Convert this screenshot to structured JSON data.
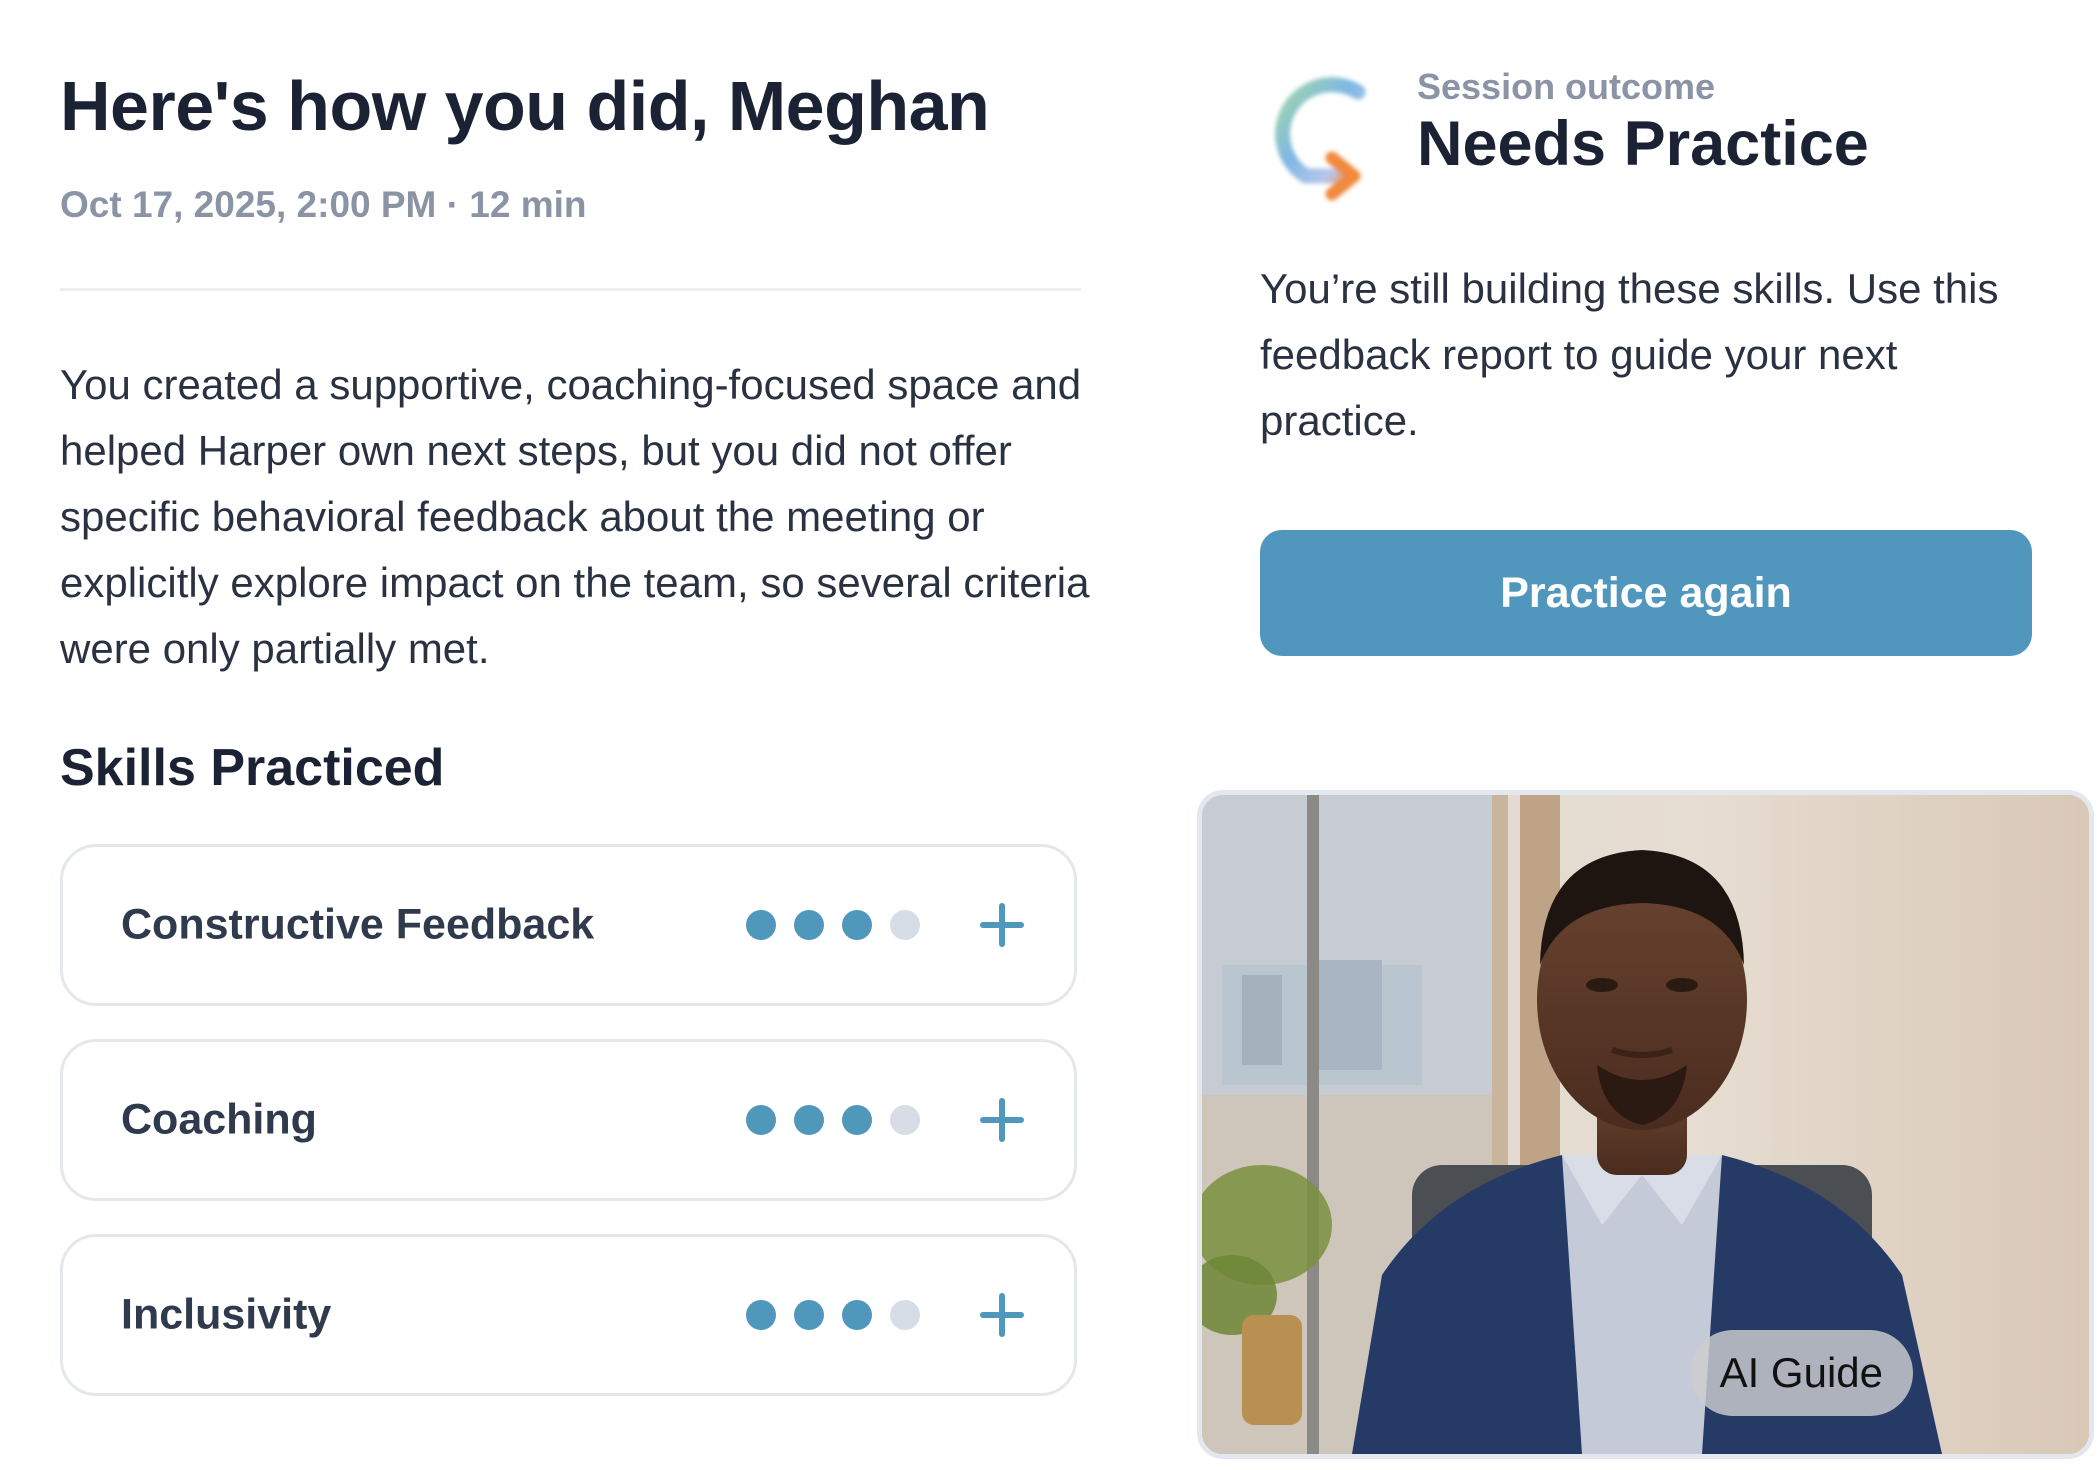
{
  "header": {
    "title": "Here's how you did, Meghan",
    "meta": "Oct 17, 2025, 2:00 PM · 12 min"
  },
  "summary": "You created a supportive, coaching-focused space and helped Harper own next steps, but you did not offer specific behavioral feedback about the meeting or explicitly explore impact on the team, so several criteria were only partially met.",
  "skills": {
    "heading": "Skills Practiced",
    "items": [
      {
        "label": "Constructive Feedback",
        "rating": 3,
        "max": 4
      },
      {
        "label": "Coaching",
        "rating": 3,
        "max": 4
      },
      {
        "label": "Inclusivity",
        "rating": 3,
        "max": 4
      }
    ]
  },
  "outcome": {
    "label": "Session outcome",
    "value": "Needs Practice",
    "icon": "circular-arrow-icon",
    "description": "You’re still building these skills. Use this feedback report to guide your next practice.",
    "button": "Practice again"
  },
  "video": {
    "badge": "AI Guide"
  },
  "colors": {
    "accent": "#5196bc",
    "dot_inactive": "#d6dde7",
    "heading": "#1b2234",
    "muted": "#8a94a5"
  }
}
